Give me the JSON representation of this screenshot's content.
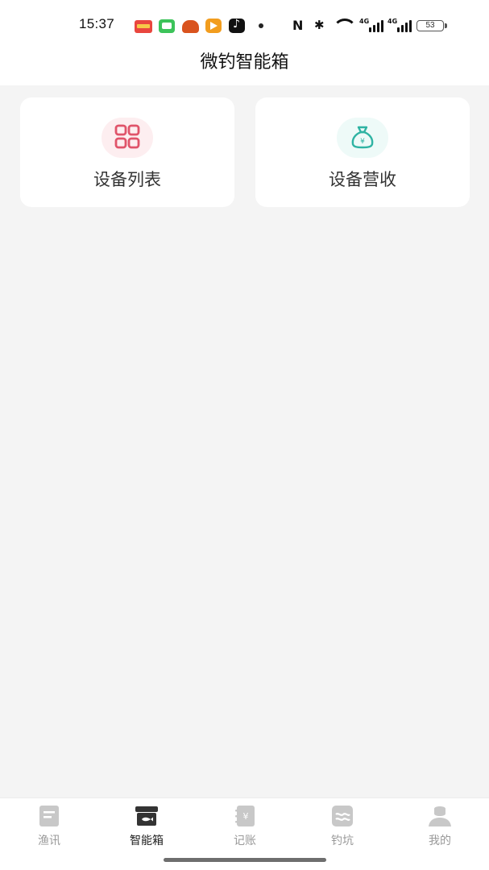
{
  "status_bar": {
    "time": "15:37",
    "battery": "53",
    "signal_tag": "4G",
    "notification_icons": [
      "toutiao-icon",
      "message-icon",
      "taobao-icon",
      "video-icon",
      "tiktok-icon"
    ]
  },
  "header": {
    "title": "微钓智能箱"
  },
  "cards": [
    {
      "label": "设备列表",
      "icon": "grid-icon",
      "accent": "#e0546a"
    },
    {
      "label": "设备营收",
      "icon": "money-bag-icon",
      "accent": "#2fb3a3"
    }
  ],
  "tabs": [
    {
      "label": "渔讯",
      "icon": "news-icon",
      "active": false
    },
    {
      "label": "智能箱",
      "icon": "box-icon",
      "active": true
    },
    {
      "label": "记账",
      "icon": "ledger-icon",
      "active": false
    },
    {
      "label": "钓坑",
      "icon": "pond-icon",
      "active": false
    },
    {
      "label": "我的",
      "icon": "profile-icon",
      "active": false
    }
  ],
  "colors": {
    "tab_inactive": "#c8c8c8",
    "tab_active": "#333333",
    "background": "#f4f4f4"
  }
}
